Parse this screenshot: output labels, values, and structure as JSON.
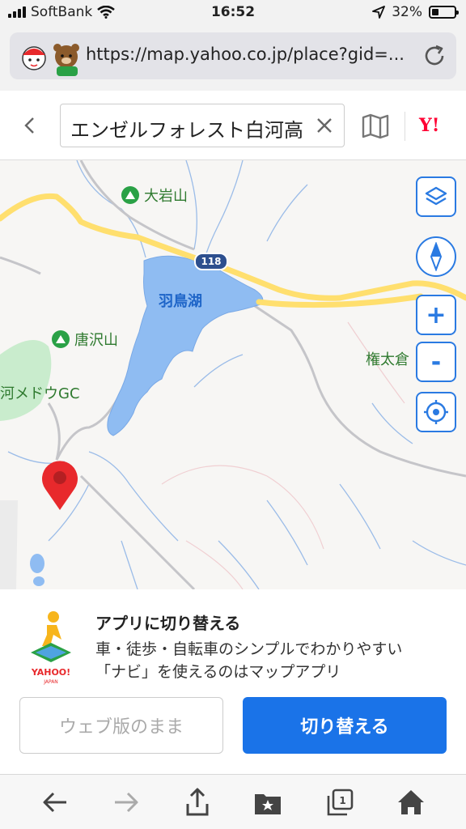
{
  "status_bar": {
    "carrier": "SoftBank",
    "time": "16:52",
    "battery": "32%",
    "battery_level": 0.32
  },
  "browser": {
    "url": "https://map.yahoo.co.jp/place?gid=..."
  },
  "header": {
    "search_value": "エンゼルフォレスト白河高",
    "logo": "Y!"
  },
  "map": {
    "labels": {
      "mountain1": "大岩山",
      "mountain2": "唐沢山",
      "lake": "羽鳥湖",
      "place": "権太倉",
      "golf": "河メドウGC",
      "route": "118"
    },
    "controls": {
      "zoom_in": "+",
      "zoom_out": "-"
    }
  },
  "app_banner": {
    "title": "アプリに切り替える",
    "desc_line1": "車・徒歩・自転車のシンプルでわかりやすい",
    "desc_line2": "「ナビ」を使えるのはマップアプリ",
    "stay_label": "ウェブ版のまま",
    "switch_label": "切り替える",
    "icon_brand": "YAHOO!",
    "icon_sub": "JAPAN"
  },
  "toolbar": {
    "tabs_count": "1"
  }
}
